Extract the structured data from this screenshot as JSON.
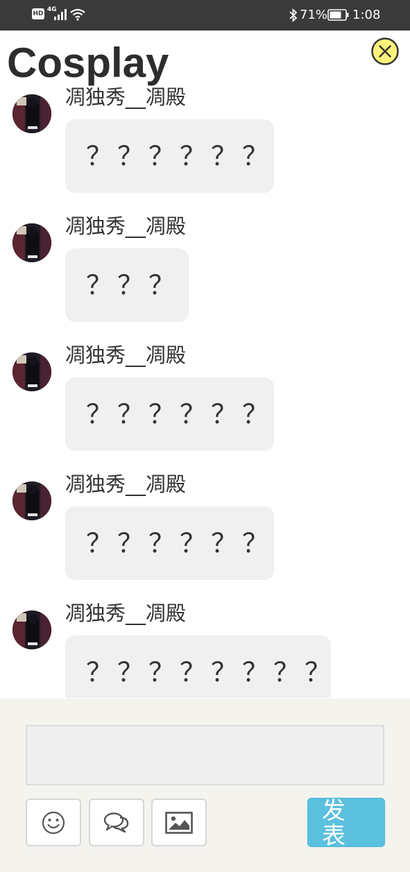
{
  "status_bar": {
    "hd_badge": "HD",
    "network": "4G",
    "battery_percent": "71%",
    "time": "1:08",
    "icons": [
      "signal-icon",
      "wifi-icon",
      "bluetooth-icon",
      "battery-icon"
    ]
  },
  "header": {
    "title": "Cosplay",
    "close_icon": "close-icon",
    "close_color": "#fef37a"
  },
  "messages": [
    {
      "user": "凋独秀__凋殿",
      "text": "？？？？？？"
    },
    {
      "user": "凋独秀__凋殿",
      "text": "？？？"
    },
    {
      "user": "凋独秀__凋殿",
      "text": "？？？？？？"
    },
    {
      "user": "凋独秀__凋殿",
      "text": "？？？？？？"
    },
    {
      "user": "凋独秀__凋殿",
      "text": "？？？？？？？？"
    }
  ],
  "composer": {
    "input_value": "",
    "emoji_icon": "smiley-icon",
    "comment_icon": "chat-bubbles-icon",
    "image_icon": "image-icon",
    "send_label": "发表",
    "send_color": "#5bc0de"
  }
}
